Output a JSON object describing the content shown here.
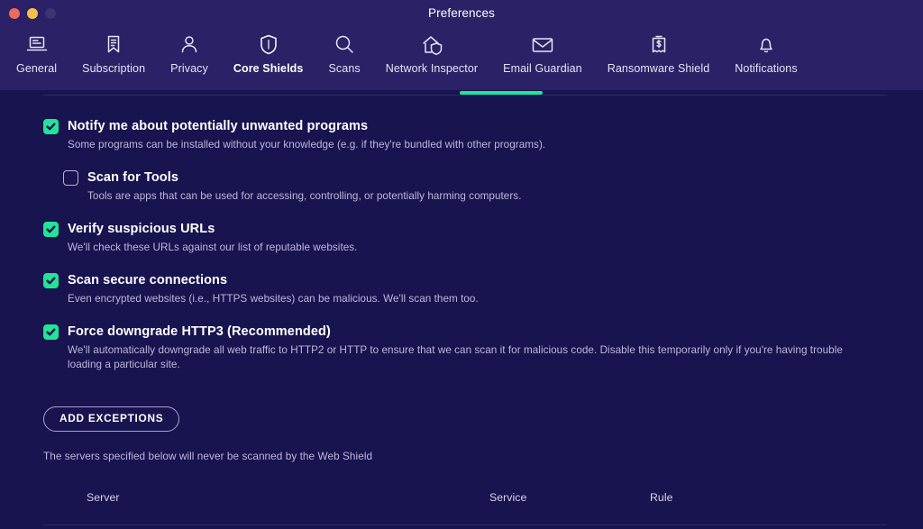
{
  "window": {
    "title": "Preferences",
    "traffic_lights": [
      {
        "name": "close",
        "color": "#ed6a5e"
      },
      {
        "name": "minimize",
        "color": "#f5bf4f"
      },
      {
        "name": "zoom",
        "color": "#3c3573"
      }
    ]
  },
  "colors": {
    "titlebar_bg": "#2a2166",
    "toolbar_bg": "#2a2166",
    "content_bg": "#181450",
    "accent_green": "#23e398",
    "checkbox_green": "#22e396",
    "text_primary": "#ffffff",
    "text_secondary": "#bdb8d8",
    "divider": "#2e2a63"
  },
  "toolbar": {
    "tabs": [
      {
        "label": "General",
        "icon": "laptop-icon",
        "active": false
      },
      {
        "label": "Subscription",
        "icon": "bookmark-icon",
        "active": false
      },
      {
        "label": "Privacy",
        "icon": "person-icon",
        "active": false
      },
      {
        "label": "Core Shields",
        "icon": "shield-icon",
        "active": true
      },
      {
        "label": "Scans",
        "icon": "magnifier-icon",
        "active": false
      },
      {
        "label": "Network Inspector",
        "icon": "house-shield-icon",
        "active": false
      },
      {
        "label": "Email Guardian",
        "icon": "envelope-icon",
        "active": false
      },
      {
        "label": "Ransomware Shield",
        "icon": "document-dollar-icon",
        "active": false
      },
      {
        "label": "Notifications",
        "icon": "bell-icon",
        "active": false
      }
    ]
  },
  "main": {
    "options": [
      {
        "title": "Notify me about potentially unwanted programs",
        "description": "Some programs can be installed without your knowledge (e.g. if they're bundled with other programs).",
        "checked": true,
        "indented": false
      },
      {
        "title": "Scan for Tools",
        "description": "Tools are apps that can be used for accessing, controlling, or potentially harming computers.",
        "checked": false,
        "indented": true
      },
      {
        "title": "Verify suspicious URLs",
        "description": "We'll check these URLs against our list of reputable websites.",
        "checked": true,
        "indented": false
      },
      {
        "title": "Scan secure connections",
        "description": "Even encrypted websites (i.e., HTTPS websites) can be malicious. We'll scan them too.",
        "checked": true,
        "indented": false
      },
      {
        "title": "Force downgrade HTTP3 (Recommended)",
        "description": "We'll automatically downgrade all web traffic to HTTP2 or HTTP to ensure that we can scan it for malicious code. Disable this temporarily only if you're having trouble loading a particular site.",
        "checked": true,
        "indented": false
      }
    ],
    "exceptions": {
      "button_label": "ADD EXCEPTIONS",
      "note": "The servers specified below will never be scanned by the Web Shield"
    },
    "table": {
      "columns": [
        "Server",
        "Service",
        "Rule"
      ],
      "rows": []
    }
  }
}
